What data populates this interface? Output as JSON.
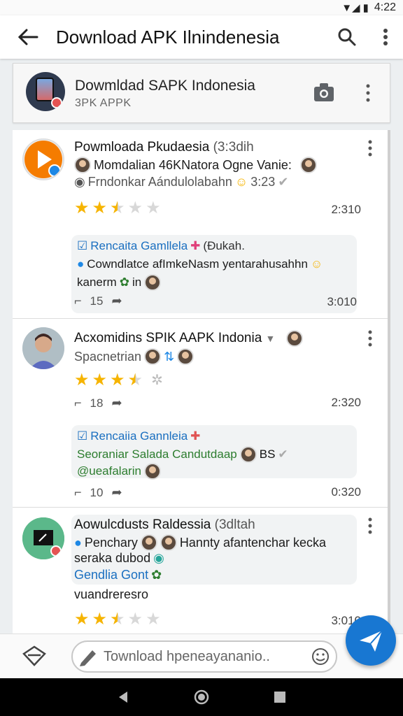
{
  "status": {
    "time": "4:22"
  },
  "app_bar": {
    "title": "Download APK Ilnindenesia",
    "back_icon": "arrow-left-icon",
    "search_icon": "search-icon",
    "more_icon": "more-vert-icon"
  },
  "channel": {
    "title": "Dowmldad SAPK Indonesia",
    "subtitle": "3PK APPK"
  },
  "posts": [
    {
      "title": "Powmloada Pkudaesia",
      "meta": "(3:3dih",
      "line1": "Momdalian 46KNatora Ogne Vanie:",
      "line2": "Frndonkar Aándulolabahn",
      "line2_time": "3:23",
      "rating": 2.5,
      "time": "2:310",
      "quote": {
        "title": "Rencaita Gamllela",
        "title_meta": "(Ðukah.",
        "line1": "Cowndlatce afImkeNasm yentarahusahhn",
        "line2": "kanerm",
        "line2_suffix": "in"
      },
      "comments": "15",
      "quote_time": "3:010"
    },
    {
      "title": "Acxomidins SPIK AAPK Indonia",
      "line1": "Spacnetrian",
      "rating": 3.5,
      "comments": "18",
      "time": "2:320",
      "quote": {
        "title": "Rencaiia Gannleia",
        "line1": "Seoraniar Salada Candutdaap",
        "line1_suffix": "BS",
        "line2": "@ueafalarin"
      },
      "quote_comments": "10",
      "quote_time": "0:320"
    },
    {
      "title": "Aowulcdusts Raldessia",
      "meta": "(3dltah",
      "line1": "Penchary",
      "line1_suffix": "Hannty afantenchar kecka",
      "line2": "seraka dubod",
      "line3": "Gendlia Gont",
      "line4": "vuandreresro",
      "rating": 2.5,
      "time": "3:010"
    }
  ],
  "composer": {
    "placeholder": "Townload hpeneayananio.."
  }
}
